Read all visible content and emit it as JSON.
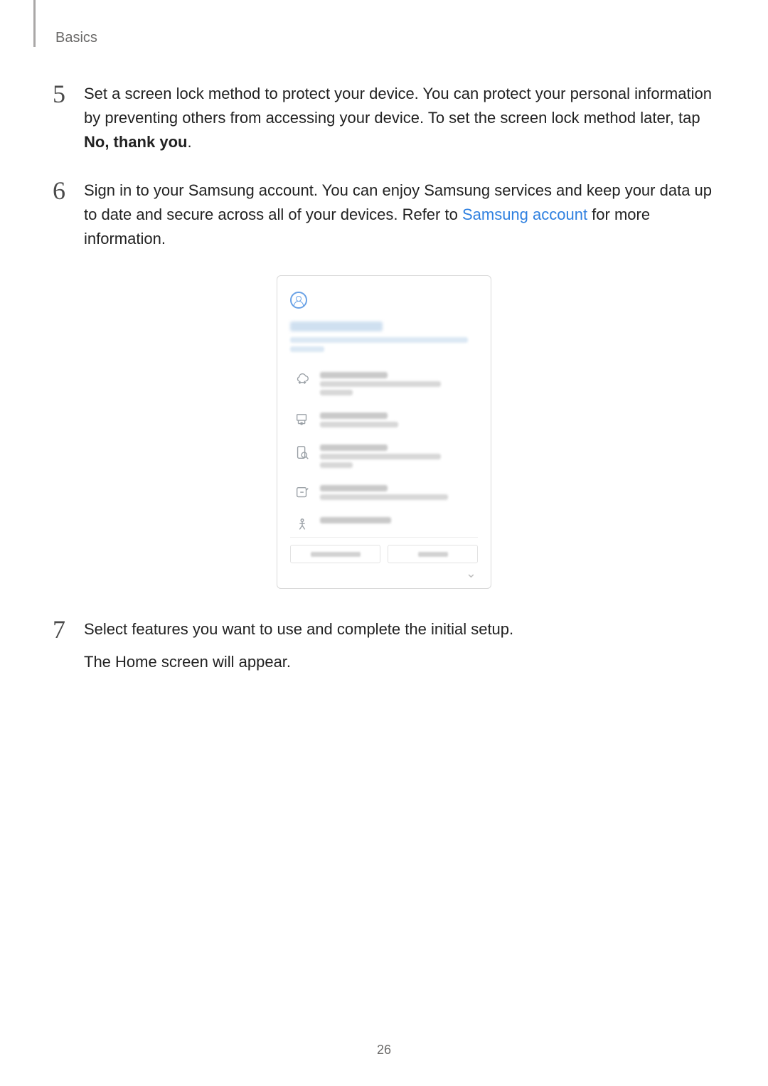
{
  "header": {
    "section_label": "Basics"
  },
  "steps": {
    "s5": {
      "number": "5",
      "text_pre": "Set a screen lock method to protect your device. You can protect your personal information by preventing others from accessing your device. To set the screen lock method later, tap ",
      "bold": "No, thank you",
      "text_post": "."
    },
    "s6": {
      "number": "6",
      "text_pre": "Sign in to your Samsung account. You can enjoy Samsung services and keep your data up to date and secure across all of your devices. Refer to ",
      "link": "Samsung account",
      "text_post": " for more information."
    },
    "s7": {
      "number": "7",
      "line1": "Select features you want to use and complete the initial setup.",
      "line2": "The Home screen will appear."
    }
  },
  "phone": {
    "title": "Samsung account",
    "subtitle": "Get the most from your Galaxy with your Samsung account.",
    "features": [
      {
        "title": "Samsung Cloud",
        "desc": "Get extra storage and share data across devices."
      },
      {
        "title": "Samsung Themes",
        "desc": "Customise your phone."
      },
      {
        "title": "Find my mobile",
        "desc": "Find your lost phone and keep your data secure."
      },
      {
        "title": "Samsung Pass",
        "desc": "Use your fingerprints to sign in to services."
      },
      {
        "title": "Samsung Health",
        "desc": ""
      }
    ],
    "buttons": {
      "create": "CREATE ACCOUNT",
      "signin": "SIGN IN"
    }
  },
  "page_number": "26"
}
